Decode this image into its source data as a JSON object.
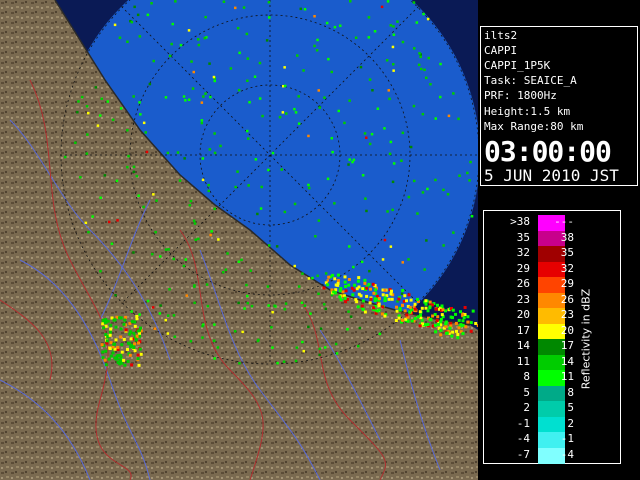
{
  "info": {
    "site": "ilts2",
    "product": "CAPPI",
    "product_name": "CAPPI_1P5K",
    "task": "Task: SEAICE_A",
    "prf": "PRF: 1800Hz",
    "height": "Height:1.5 km",
    "max_range": "Max Range:80 km",
    "time": "03:00:00",
    "date": "5 JUN 2010 JST"
  },
  "legend": {
    "title": "Reflectivity in dBZ",
    "rows": [
      {
        "left": ">38",
        "right": "---",
        "color": "#ff00ff"
      },
      {
        "left": "35",
        "right": "38",
        "color": "#c8008c"
      },
      {
        "left": "32",
        "right": "35",
        "color": "#a00000"
      },
      {
        "left": "29",
        "right": "32",
        "color": "#e60000"
      },
      {
        "left": "26",
        "right": "29",
        "color": "#ff4400"
      },
      {
        "left": "23",
        "right": "26",
        "color": "#ff8800"
      },
      {
        "left": "20",
        "right": "23",
        "color": "#ffbb00"
      },
      {
        "left": "17",
        "right": "20",
        "color": "#ffff00"
      },
      {
        "left": "14",
        "right": "17",
        "color": "#008800"
      },
      {
        "left": "11",
        "right": "14",
        "color": "#00cc00"
      },
      {
        "left": "8",
        "right": "11",
        "color": "#00ff00"
      },
      {
        "left": "5",
        "right": "8",
        "color": "#00aa88"
      },
      {
        "left": "2",
        "right": "5",
        "color": "#00ccaa"
      },
      {
        "left": "-1",
        "right": "2",
        "color": "#00e0d0"
      },
      {
        "left": "-4",
        "right": "-1",
        "color": "#40f0f0"
      },
      {
        "left": "-7",
        "right": "-4",
        "color": "#80ffff"
      }
    ]
  },
  "colors": {
    "ocean_echo": "#1a5ccc",
    "land": "#7a6a50",
    "range_rings": "#111111",
    "rivers": "#5a6ad8",
    "boundaries": "#b03030"
  }
}
